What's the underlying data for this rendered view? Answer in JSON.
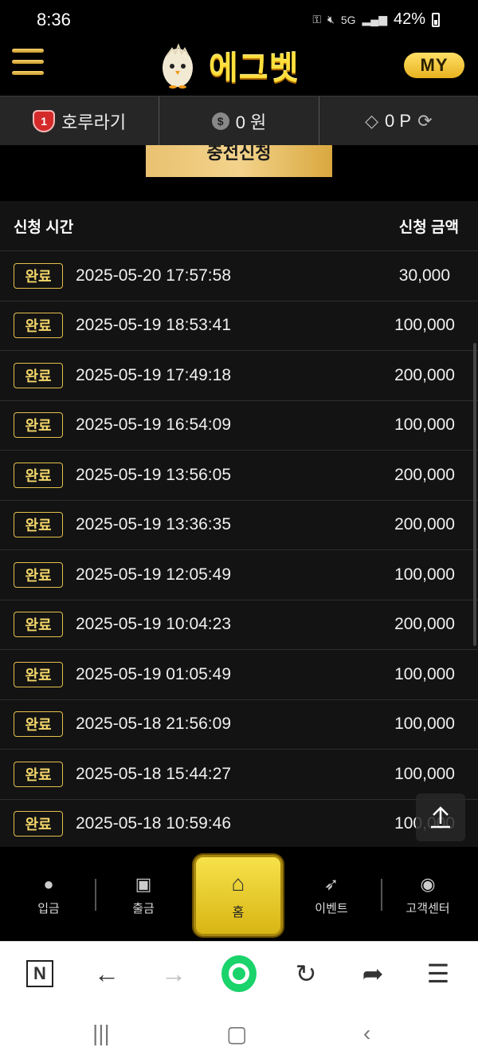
{
  "status_bar": {
    "time": "8:36",
    "battery": "42%",
    "network": "5G"
  },
  "header": {
    "logo_text": "에그벳",
    "my_label": "MY"
  },
  "info_bar": {
    "level": "1",
    "username": "호루라기",
    "money": "0 원",
    "points": "0 P"
  },
  "charge_button_label": "충전신청",
  "table": {
    "col_time": "신청 시간",
    "col_amount": "신청 금액",
    "rows": [
      {
        "status": "완료",
        "time": "2025-05-20 17:57:58",
        "amount": "30,000"
      },
      {
        "status": "완료",
        "time": "2025-05-19 18:53:41",
        "amount": "100,000"
      },
      {
        "status": "완료",
        "time": "2025-05-19 17:49:18",
        "amount": "200,000"
      },
      {
        "status": "완료",
        "time": "2025-05-19 16:54:09",
        "amount": "100,000"
      },
      {
        "status": "완료",
        "time": "2025-05-19 13:56:05",
        "amount": "200,000"
      },
      {
        "status": "완료",
        "time": "2025-05-19 13:36:35",
        "amount": "200,000"
      },
      {
        "status": "완료",
        "time": "2025-05-19 12:05:49",
        "amount": "100,000"
      },
      {
        "status": "완료",
        "time": "2025-05-19 10:04:23",
        "amount": "200,000"
      },
      {
        "status": "완료",
        "time": "2025-05-19 01:05:49",
        "amount": "100,000"
      },
      {
        "status": "완료",
        "time": "2025-05-18 21:56:09",
        "amount": "100,000"
      },
      {
        "status": "완료",
        "time": "2025-05-18 15:44:27",
        "amount": "100,000"
      },
      {
        "status": "완료",
        "time": "2025-05-18 10:59:46",
        "amount": "100,000"
      }
    ]
  },
  "bottom_nav": {
    "deposit": "입금",
    "withdraw": "출금",
    "home": "홈",
    "event": "이벤트",
    "support": "고객센터"
  },
  "colors": {
    "accent_gold": "#e5c04e",
    "home_yellow": "#f7e24a",
    "browser_green": "#1ad36b"
  }
}
